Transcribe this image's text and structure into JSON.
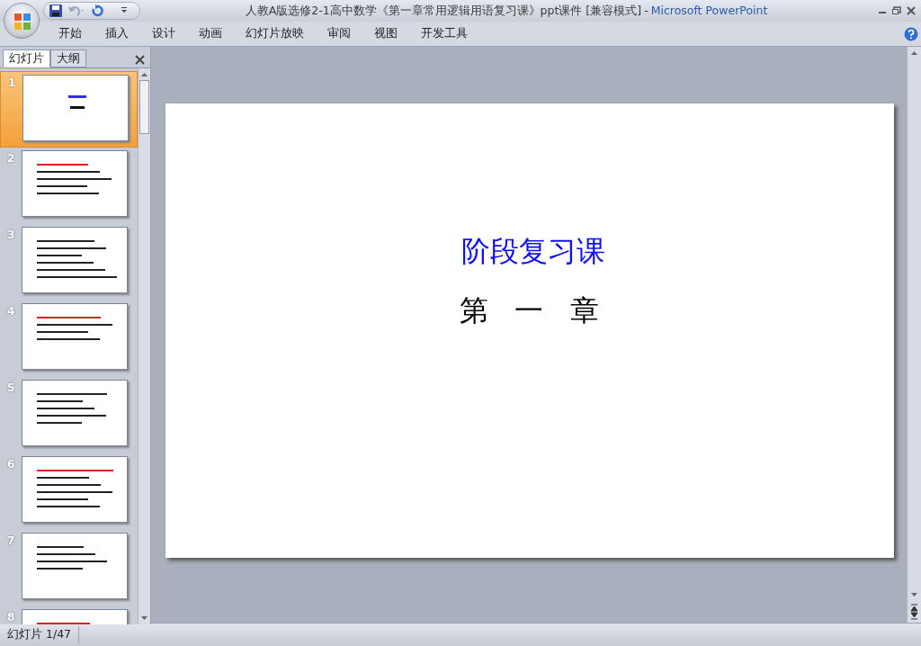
{
  "window": {
    "title": "人教A版选修2-1高中数学《第一章常用逻辑用语复习课》ppt课件 [兼容模式]",
    "separator": "-",
    "app_name": "Microsoft PowerPoint"
  },
  "ribbon_tabs": [
    "开始",
    "插入",
    "设计",
    "动画",
    "幻灯片放映",
    "审阅",
    "视图",
    "开发工具"
  ],
  "pane_tabs": [
    {
      "label": "幻灯片",
      "selected": true
    },
    {
      "label": "大纲",
      "selected": false
    }
  ],
  "slides": [
    {
      "number": "1",
      "selected": true
    },
    {
      "number": "2",
      "selected": false
    },
    {
      "number": "3",
      "selected": false
    },
    {
      "number": "4",
      "selected": false
    },
    {
      "number": "5",
      "selected": false
    },
    {
      "number": "6",
      "selected": false
    },
    {
      "number": "7",
      "selected": false
    },
    {
      "number": "8",
      "selected": false
    }
  ],
  "current_slide": {
    "title": "阶段复习课",
    "subtitle": "第 一 章"
  },
  "status_bar": {
    "slide_count": "幻灯片 1/47"
  }
}
